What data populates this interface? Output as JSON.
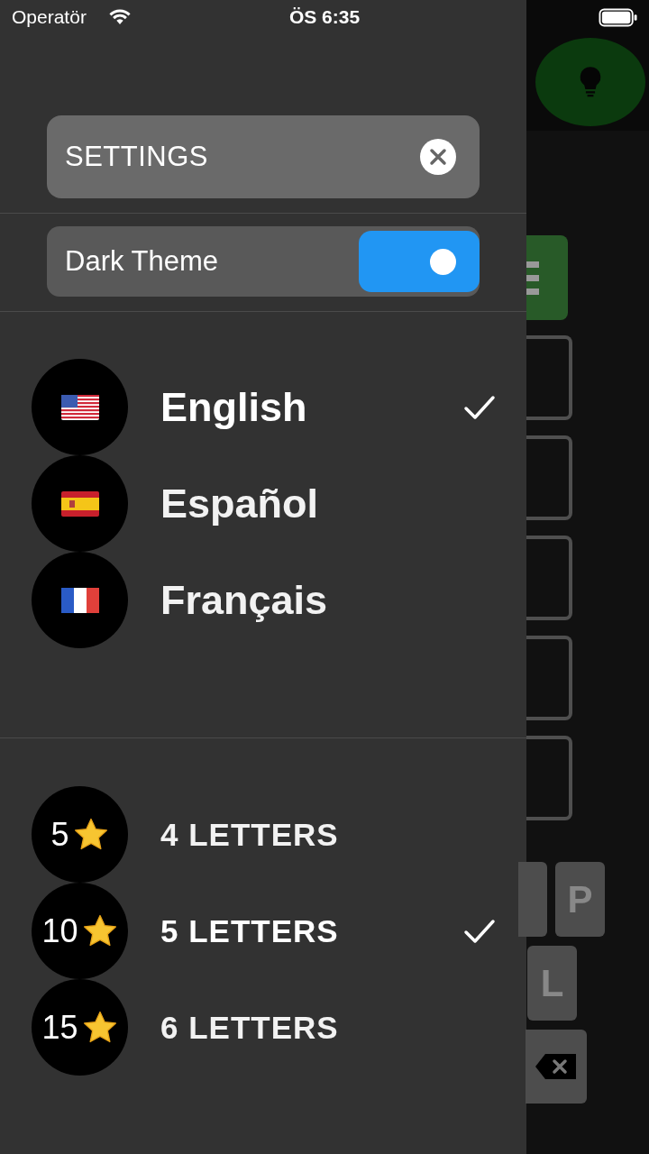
{
  "status_bar": {
    "carrier": "Operatör",
    "time": "ÖS 6:35"
  },
  "settings": {
    "title": "SETTINGS"
  },
  "dark_theme": {
    "label": "Dark Theme",
    "on": true
  },
  "languages": [
    {
      "name": "English",
      "kind": "us",
      "selected": true
    },
    {
      "name": "Español",
      "kind": "es",
      "selected": false
    },
    {
      "name": "Français",
      "kind": "fr",
      "selected": false
    }
  ],
  "levels": [
    {
      "points": "5",
      "label": "4 LETTERS",
      "selected": false
    },
    {
      "points": "10",
      "label": "5 LETTERS",
      "selected": true
    },
    {
      "points": "15",
      "label": "6 LETTERS",
      "selected": false
    }
  ],
  "background_keys": [
    {
      "label": "P"
    },
    {
      "label": "L"
    }
  ]
}
